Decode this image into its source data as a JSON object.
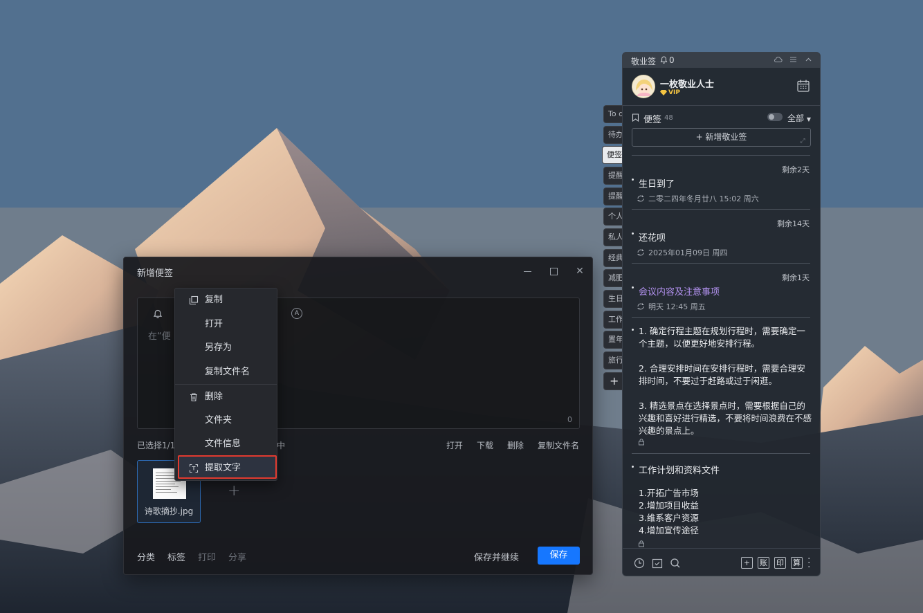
{
  "note_window": {
    "title": "新增便签",
    "placeholder": "在“便",
    "char_count": "0",
    "selection_status": "已选择1/1",
    "selection_status_tail": "中",
    "file_actions": [
      "打开",
      "下载",
      "删除",
      "复制文件名"
    ],
    "attachment": {
      "file_name": "诗歌摘抄.jpg"
    },
    "footer_left": [
      "分类",
      "标签",
      "打印",
      "分享"
    ],
    "save_continue": "保存并继续",
    "save": "保存"
  },
  "context_menu": {
    "items": [
      {
        "label": "复制",
        "icon": "copy-icon"
      },
      {
        "label": "打开",
        "icon": ""
      },
      {
        "label": "另存为",
        "icon": ""
      },
      {
        "label": "复制文件名",
        "icon": ""
      },
      {
        "label": "删除",
        "icon": "trash-icon"
      },
      {
        "label": "文件夹",
        "icon": ""
      },
      {
        "label": "文件信息",
        "icon": ""
      },
      {
        "label": "提取文字",
        "icon": "text-extract-icon"
      }
    ],
    "highlighted_index": 7,
    "highlight_color": "#e23a2f"
  },
  "side_tabs": [
    "To d",
    "待办",
    "便签",
    "提醒",
    "提醒",
    "个人",
    "私人",
    "经典",
    "减肥",
    "生日",
    "工作",
    "置年",
    "旅行",
    "+"
  ],
  "panel": {
    "app_name": "敬业签",
    "notification_count": "0",
    "user_name": "一枚敬业人士",
    "vip_label": "VIP",
    "section_title": "便签",
    "section_count": "48",
    "filter_label": "全部",
    "new_button": "+ 新增敬业签",
    "notes": [
      {
        "remaining": "剩余2天",
        "title": "生日到了",
        "time": "二零二四年冬月廿八 15:02 周六",
        "purple": false
      },
      {
        "remaining": "剩余14天",
        "title": "还花呗",
        "time": "2025年01月09日 周四",
        "purple": false
      },
      {
        "remaining": "剩余1天",
        "title": "会议内容及注意事项",
        "time": "明天 12:45 周五",
        "purple": true
      }
    ],
    "note_plan": [
      "1. 确定行程主题在规划行程时，需要确定一个主题，以便更好地安排行程。",
      "2. 合理安排时间在安排行程时，需要合理安排时间，不要过于赶路或过于闲逛。",
      "3. 精选景点在选择景点时，需要根据自己的兴趣和喜好进行精选，不要将时间浪费在不感兴趣的景点上。"
    ],
    "note_work": {
      "title": "工作计划和资料文件",
      "lines": [
        "1.开拓广告市场",
        "2.增加项目收益",
        "3.维系客户资源",
        "4.增加宣传途径"
      ]
    },
    "bottom_boxes": [
      "+",
      "账",
      "印",
      "算"
    ]
  },
  "colors": {
    "accent": "#1677ff",
    "purple_title": "#b392f0",
    "vip": "#f5c542"
  }
}
